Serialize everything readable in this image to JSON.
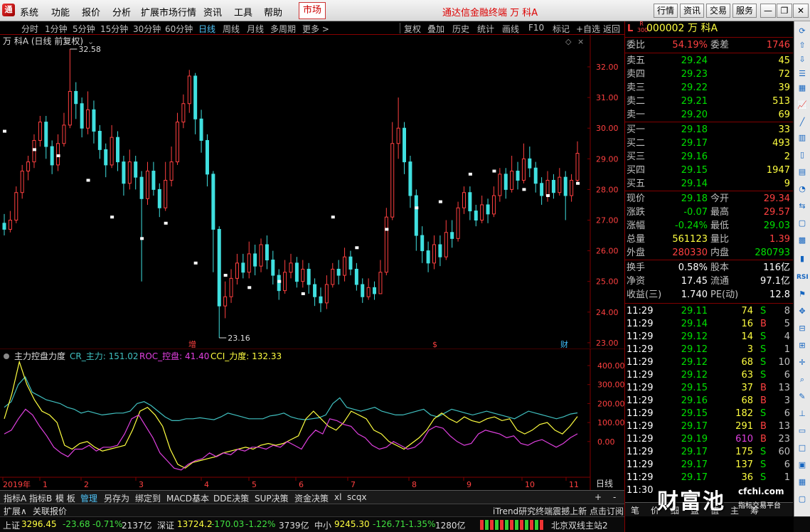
{
  "menu": {
    "logo": "通",
    "items": [
      "系统",
      "功能",
      "报价",
      "分析",
      "扩展市场行情",
      "资讯",
      "工具",
      "帮助"
    ],
    "market_tab": "市场",
    "title": "通达信金融终端  万 科A",
    "right_buttons": [
      "行情",
      "资讯",
      "交易",
      "服务"
    ]
  },
  "toolbar": {
    "periods": [
      "分时",
      "1分钟",
      "5分钟",
      "15分钟",
      "30分钟",
      "60分钟",
      "日线",
      "周线",
      "月线",
      "多周期",
      "更多 >"
    ],
    "active_period": "日线",
    "actions": [
      "复权",
      "叠加",
      "历史",
      "统计",
      "画线",
      "F10",
      "标记",
      "+自选",
      "返回"
    ]
  },
  "chart": {
    "title": "万 科A (日线 前复权)",
    "price_ticks": [
      "32.00",
      "31.00",
      "30.00",
      "29.00",
      "28.00",
      "27.00",
      "26.00",
      "25.00",
      "24.00",
      "23.00"
    ],
    "high_label": "32.58",
    "low_label": "23.16",
    "markers": [
      "增",
      "$",
      "财"
    ],
    "candles": [
      [
        26.9,
        26.7,
        27.2,
        26.5
      ],
      [
        26.7,
        27.0,
        27.3,
        26.6
      ],
      [
        27.0,
        27.9,
        28.1,
        26.9
      ],
      [
        27.9,
        28.6,
        28.8,
        27.7
      ],
      [
        28.6,
        28.9,
        29.1,
        28.3
      ],
      [
        28.9,
        29.6,
        29.8,
        28.7
      ],
      [
        29.6,
        30.2,
        30.4,
        29.4
      ],
      [
        30.2,
        29.4,
        30.4,
        29.0
      ],
      [
        29.4,
        28.8,
        29.6,
        28.5
      ],
      [
        28.8,
        29.5,
        29.8,
        28.6
      ],
      [
        29.5,
        30.1,
        30.5,
        29.4
      ],
      [
        30.1,
        31.2,
        32.58,
        30.0
      ],
      [
        31.2,
        30.8,
        31.5,
        30.3
      ],
      [
        30.8,
        30.0,
        31.0,
        29.7
      ],
      [
        30.0,
        30.6,
        31.2,
        29.8
      ],
      [
        30.6,
        29.9,
        30.9,
        29.5
      ],
      [
        29.9,
        29.3,
        30.1,
        29.0
      ],
      [
        29.3,
        28.8,
        29.5,
        28.4
      ],
      [
        28.8,
        29.7,
        30.1,
        28.7
      ],
      [
        29.7,
        28.9,
        29.9,
        28.6
      ],
      [
        28.9,
        28.2,
        29.1,
        27.8
      ],
      [
        28.2,
        28.9,
        29.3,
        28.0
      ],
      [
        28.9,
        28.4,
        29.1,
        28.0
      ],
      [
        28.4,
        27.7,
        28.6,
        25.0
      ],
      [
        27.7,
        28.6,
        28.9,
        27.5
      ],
      [
        28.6,
        28.0,
        28.9,
        27.8
      ],
      [
        28.0,
        27.4,
        28.2,
        27.1
      ],
      [
        27.4,
        28.3,
        28.9,
        27.3
      ],
      [
        28.3,
        28.9,
        29.4,
        28.1
      ],
      [
        28.9,
        30.2,
        30.5,
        28.8
      ],
      [
        30.2,
        30.8,
        31.1,
        30.0
      ],
      [
        30.8,
        31.7,
        31.9,
        30.5
      ],
      [
        31.7,
        30.3,
        31.8,
        29.8
      ],
      [
        30.3,
        29.6,
        30.6,
        29.2
      ],
      [
        29.6,
        28.5,
        29.8,
        28.1
      ],
      [
        28.5,
        26.7,
        28.6,
        25.3
      ],
      [
        26.7,
        24.2,
        26.8,
        23.16
      ],
      [
        24.2,
        24.5,
        25.0,
        23.8
      ],
      [
        24.5,
        25.1,
        25.4,
        24.3
      ],
      [
        25.1,
        25.6,
        25.9,
        24.9
      ],
      [
        25.6,
        25.3,
        25.9,
        25.1
      ],
      [
        25.3,
        25.9,
        26.3,
        25.1
      ],
      [
        25.9,
        25.5,
        26.2,
        25.2
      ],
      [
        25.5,
        26.2,
        26.4,
        25.3
      ],
      [
        26.2,
        25.7,
        26.5,
        25.4
      ],
      [
        25.7,
        25.2,
        26.0,
        24.9
      ],
      [
        25.2,
        24.7,
        25.4,
        24.4
      ],
      [
        24.7,
        25.3,
        25.7,
        24.6
      ],
      [
        25.3,
        25.6,
        25.9,
        25.1
      ],
      [
        25.6,
        25.0,
        25.8,
        24.8
      ],
      [
        25.0,
        25.4,
        25.7,
        24.8
      ],
      [
        25.4,
        24.9,
        25.6,
        24.6
      ],
      [
        24.9,
        24.5,
        25.1,
        24.2
      ],
      [
        24.5,
        24.3,
        24.8,
        24.0
      ],
      [
        24.3,
        24.9,
        25.2,
        24.1
      ],
      [
        24.9,
        25.4,
        25.6,
        24.8
      ],
      [
        25.4,
        25.2,
        25.7,
        24.9
      ],
      [
        25.2,
        25.8,
        26.1,
        25.0
      ],
      [
        25.8,
        25.4,
        26.0,
        25.2
      ],
      [
        25.4,
        24.9,
        25.6,
        24.7
      ],
      [
        24.9,
        24.5,
        25.1,
        24.3
      ],
      [
        24.5,
        24.8,
        25.1,
        24.4
      ],
      [
        24.8,
        24.6,
        25.0,
        24.4
      ],
      [
        24.6,
        25.3,
        25.7,
        24.6
      ],
      [
        25.3,
        27.1,
        27.4,
        25.2
      ],
      [
        27.1,
        29.5,
        30.2,
        27.0
      ],
      [
        29.5,
        30.0,
        31.0,
        29.0
      ],
      [
        30.0,
        28.9,
        30.2,
        28.5
      ],
      [
        28.9,
        27.8,
        29.1,
        27.4
      ],
      [
        27.8,
        26.5,
        28.0,
        26.0
      ],
      [
        26.5,
        26.0,
        26.8,
        25.6
      ],
      [
        26.0,
        25.6,
        26.3,
        25.3
      ],
      [
        25.6,
        26.2,
        26.5,
        25.4
      ],
      [
        26.2,
        25.8,
        26.5,
        25.5
      ],
      [
        25.8,
        26.6,
        27.0,
        25.7
      ],
      [
        26.6,
        26.4,
        27.0,
        26.1
      ],
      [
        26.4,
        27.4,
        27.6,
        26.3
      ],
      [
        27.4,
        27.9,
        28.1,
        27.2
      ],
      [
        27.9,
        27.3,
        28.1,
        27.0
      ],
      [
        27.3,
        27.0,
        27.5,
        26.8
      ],
      [
        27.0,
        27.5,
        27.8,
        26.9
      ],
      [
        27.5,
        27.2,
        27.7,
        26.9
      ],
      [
        27.2,
        27.8,
        28.1,
        27.1
      ],
      [
        27.8,
        28.5,
        28.7,
        27.6
      ],
      [
        28.5,
        28.0,
        28.7,
        27.7
      ],
      [
        28.0,
        28.6,
        29.1,
        27.9
      ],
      [
        28.6,
        28.3,
        28.9,
        28.0
      ],
      [
        28.3,
        29.0,
        29.5,
        28.2
      ],
      [
        29.0,
        28.7,
        29.4,
        28.4
      ],
      [
        28.7,
        28.2,
        28.9,
        27.9
      ],
      [
        28.2,
        27.8,
        28.4,
        27.5
      ],
      [
        27.8,
        28.3,
        28.6,
        27.6
      ],
      [
        28.3,
        27.9,
        28.5,
        27.7
      ],
      [
        27.9,
        28.4,
        28.7,
        27.8
      ],
      [
        28.4,
        27.8,
        28.6,
        27.0
      ],
      [
        27.8,
        28.3,
        28.5,
        27.6
      ],
      [
        28.3,
        29.18,
        29.57,
        28.2
      ]
    ],
    "ma_markers": [
      29.9,
      29.3,
      29.1,
      28.3,
      27.1,
      26.4,
      26.9,
      25.6,
      25.2,
      24.8,
      25.0,
      24.6,
      27.1,
      26.1,
      26.7,
      27.4,
      27.6,
      28.5,
      28.6,
      28.0,
      27.8,
      28.2
    ]
  },
  "indicator": {
    "name": "主力控盘力度",
    "cr_label": "CR_主力: 151.02",
    "roc_label": "ROC_控盘: 41.40",
    "cci_label": "CCI_力度: 132.33",
    "ticks": [
      "400.00",
      "300.00",
      "200.00",
      "100.00",
      "0.00"
    ],
    "cr": [
      180,
      210,
      300,
      340,
      260,
      240,
      220,
      210,
      200,
      180,
      170,
      150,
      160,
      150,
      140,
      145,
      150,
      150,
      160,
      200,
      210,
      190,
      160,
      130,
      110,
      110,
      120,
      120,
      125,
      120,
      115,
      130,
      150,
      140,
      130,
      120,
      120,
      120,
      135,
      140,
      150,
      130,
      120,
      115,
      120,
      125,
      140,
      200,
      230,
      180,
      170,
      160,
      170,
      180,
      160,
      150,
      140,
      140,
      150,
      160,
      170,
      140,
      130,
      150,
      170,
      160,
      150,
      140,
      150,
      160,
      150,
      140,
      130,
      120,
      140,
      160,
      150,
      140,
      130,
      120,
      130,
      145,
      151
    ],
    "roc": [
      40,
      60,
      120,
      170,
      140,
      80,
      30,
      -30,
      -60,
      -80,
      -40,
      -40,
      -20,
      -50,
      -30,
      -30,
      -20,
      40,
      120,
      140,
      80,
      20,
      -60,
      -100,
      -140,
      -150,
      -120,
      -100,
      -90,
      -60,
      -80,
      -60,
      -70,
      -40,
      -50,
      -30,
      -30,
      -40,
      -20,
      -30,
      0,
      -20,
      -40,
      20,
      60,
      40,
      120,
      110,
      90,
      80,
      40,
      20,
      -20,
      -40,
      -30,
      0,
      -20,
      -40,
      -30,
      0,
      60,
      80,
      70,
      30,
      0,
      -20,
      -10,
      40,
      60,
      50,
      40,
      20,
      30,
      -10,
      -20,
      0,
      10,
      -10,
      -30,
      -10,
      20,
      41
    ],
    "cci": [
      120,
      250,
      420,
      300,
      220,
      160,
      140,
      100,
      -20,
      -40,
      -10,
      0,
      -30,
      -50,
      -40,
      -30,
      -20,
      60,
      160,
      180,
      140,
      80,
      -40,
      -120,
      -140,
      -110,
      -100,
      -90,
      -80,
      -60,
      -50,
      -40,
      -30,
      -40,
      -20,
      -10,
      -20,
      -10,
      10,
      30,
      120,
      160,
      120,
      80,
      60,
      100,
      160,
      140,
      120,
      60,
      40,
      0,
      -20,
      -40,
      -10,
      20,
      60,
      120,
      150,
      120,
      100,
      130,
      110,
      100,
      120,
      130,
      110,
      120,
      60,
      40,
      60,
      90,
      100,
      60,
      40,
      80,
      132
    ]
  },
  "x_axis": {
    "labels": [
      "2019年",
      "1",
      "2",
      "3",
      "4",
      "5",
      "6",
      "7",
      "8",
      "9",
      "10",
      "11"
    ],
    "right_label": "日线"
  },
  "bottom_tabs": [
    "指标A",
    "指标B",
    "模 板",
    "管理",
    "另存为",
    "绑定到",
    "MACD基本",
    "DDE决策",
    "SUP决策",
    "资金决策",
    "xl",
    "scqx"
  ],
  "ext_tabs": [
    "扩展∧",
    "关联报价"
  ],
  "news_ticker": "iTrend研究终端震撼上新  点击订阅",
  "status": {
    "sh": {
      "name": "上证",
      "value": "3296.45",
      "chg": "-23.68",
      "pct": "-0.71%",
      "vol": "2137亿"
    },
    "sz": {
      "name": "深证",
      "value": "13724.2",
      "chg": "-170.03",
      "pct": "-1.22%",
      "vol": "3739亿"
    },
    "zx": {
      "name": "中小",
      "value": "9245.30",
      "chg": "-126.71",
      "pct": "-1.35%",
      "vol": "1280亿"
    },
    "server": "北京双线主站2"
  },
  "quote": {
    "code_badge": "L",
    "r_badge": "R 300",
    "code": "000002",
    "name": "万 科A",
    "webi_label": "委比",
    "webi": "54.19%",
    "weicha_label": "委差",
    "weicha": "1746",
    "asks": [
      [
        "卖五",
        "29.24",
        "45"
      ],
      [
        "卖四",
        "29.23",
        "72"
      ],
      [
        "卖三",
        "29.22",
        "39"
      ],
      [
        "卖二",
        "29.21",
        "513"
      ],
      [
        "卖一",
        "29.20",
        "69"
      ]
    ],
    "bids": [
      [
        "买一",
        "29.18",
        "33"
      ],
      [
        "买二",
        "29.17",
        "493"
      ],
      [
        "买三",
        "29.16",
        "2"
      ],
      [
        "买四",
        "29.15",
        "1947"
      ],
      [
        "买五",
        "29.14",
        "9"
      ]
    ],
    "stats": [
      [
        "现价",
        "29.18",
        "今开",
        "29.34"
      ],
      [
        "涨跌",
        "-0.07",
        "最高",
        "29.57"
      ],
      [
        "涨幅",
        "-0.24%",
        "最低",
        "29.03"
      ],
      [
        "总量",
        "561123",
        "量比",
        "1.39"
      ],
      [
        "外盘",
        "280330",
        "内盘",
        "280793"
      ]
    ],
    "fund": [
      [
        "换手",
        "0.58%",
        "股本",
        "116亿"
      ],
      [
        "净资",
        "17.45",
        "流通",
        "97.1亿"
      ],
      [
        "收益(三)",
        "1.740",
        "PE(动)",
        "12.8"
      ]
    ],
    "ticks": [
      [
        "11:29",
        "29.11",
        "74",
        "S",
        "8"
      ],
      [
        "11:29",
        "29.14",
        "16",
        "B",
        "5"
      ],
      [
        "11:29",
        "29.12",
        "14",
        "S",
        "4"
      ],
      [
        "11:29",
        "29.12",
        "3",
        "S",
        "1"
      ],
      [
        "11:29",
        "29.12",
        "68",
        "S",
        "10"
      ],
      [
        "11:29",
        "29.12",
        "63",
        "S",
        "6"
      ],
      [
        "11:29",
        "29.15",
        "37",
        "B",
        "13"
      ],
      [
        "11:29",
        "29.16",
        "68",
        "B",
        "3"
      ],
      [
        "11:29",
        "29.15",
        "182",
        "S",
        "6"
      ],
      [
        "11:29",
        "29.17",
        "291",
        "B",
        "13"
      ],
      [
        "11:29",
        "29.19",
        "610",
        "B",
        "23"
      ],
      [
        "11:29",
        "29.17",
        "175",
        "S",
        "60"
      ],
      [
        "11:29",
        "29.17",
        "137",
        "S",
        "6"
      ],
      [
        "11:29",
        "29.17",
        "36",
        "S",
        "1"
      ],
      [
        "11:30",
        "",
        "",
        "",
        ""
      ]
    ],
    "bottom_tabs": [
      "笔",
      "价",
      "细",
      "盘",
      "值",
      "主",
      "筹"
    ]
  },
  "watermark": {
    "brand": "财富池",
    "site": "cfchi.com",
    "tagline": "指标交易平台"
  },
  "colors": {
    "up": "#ff4040",
    "down": "#40e0e0",
    "bg": "#000000",
    "grid": "#800000",
    "cr": "#40c0c0",
    "roc": "#e040e0",
    "cci": "#ffff40"
  }
}
